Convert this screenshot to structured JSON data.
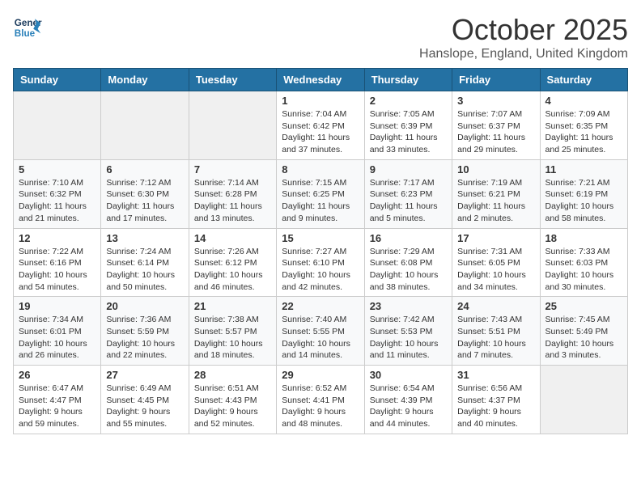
{
  "logo": {
    "line1": "General",
    "line2": "Blue"
  },
  "title": "October 2025",
  "location": "Hanslope, England, United Kingdom",
  "days_of_week": [
    "Sunday",
    "Monday",
    "Tuesday",
    "Wednesday",
    "Thursday",
    "Friday",
    "Saturday"
  ],
  "weeks": [
    [
      {
        "day": "",
        "info": ""
      },
      {
        "day": "",
        "info": ""
      },
      {
        "day": "",
        "info": ""
      },
      {
        "day": "1",
        "info": "Sunrise: 7:04 AM\nSunset: 6:42 PM\nDaylight: 11 hours\nand 37 minutes."
      },
      {
        "day": "2",
        "info": "Sunrise: 7:05 AM\nSunset: 6:39 PM\nDaylight: 11 hours\nand 33 minutes."
      },
      {
        "day": "3",
        "info": "Sunrise: 7:07 AM\nSunset: 6:37 PM\nDaylight: 11 hours\nand 29 minutes."
      },
      {
        "day": "4",
        "info": "Sunrise: 7:09 AM\nSunset: 6:35 PM\nDaylight: 11 hours\nand 25 minutes."
      }
    ],
    [
      {
        "day": "5",
        "info": "Sunrise: 7:10 AM\nSunset: 6:32 PM\nDaylight: 11 hours\nand 21 minutes."
      },
      {
        "day": "6",
        "info": "Sunrise: 7:12 AM\nSunset: 6:30 PM\nDaylight: 11 hours\nand 17 minutes."
      },
      {
        "day": "7",
        "info": "Sunrise: 7:14 AM\nSunset: 6:28 PM\nDaylight: 11 hours\nand 13 minutes."
      },
      {
        "day": "8",
        "info": "Sunrise: 7:15 AM\nSunset: 6:25 PM\nDaylight: 11 hours\nand 9 minutes."
      },
      {
        "day": "9",
        "info": "Sunrise: 7:17 AM\nSunset: 6:23 PM\nDaylight: 11 hours\nand 5 minutes."
      },
      {
        "day": "10",
        "info": "Sunrise: 7:19 AM\nSunset: 6:21 PM\nDaylight: 11 hours\nand 2 minutes."
      },
      {
        "day": "11",
        "info": "Sunrise: 7:21 AM\nSunset: 6:19 PM\nDaylight: 10 hours\nand 58 minutes."
      }
    ],
    [
      {
        "day": "12",
        "info": "Sunrise: 7:22 AM\nSunset: 6:16 PM\nDaylight: 10 hours\nand 54 minutes."
      },
      {
        "day": "13",
        "info": "Sunrise: 7:24 AM\nSunset: 6:14 PM\nDaylight: 10 hours\nand 50 minutes."
      },
      {
        "day": "14",
        "info": "Sunrise: 7:26 AM\nSunset: 6:12 PM\nDaylight: 10 hours\nand 46 minutes."
      },
      {
        "day": "15",
        "info": "Sunrise: 7:27 AM\nSunset: 6:10 PM\nDaylight: 10 hours\nand 42 minutes."
      },
      {
        "day": "16",
        "info": "Sunrise: 7:29 AM\nSunset: 6:08 PM\nDaylight: 10 hours\nand 38 minutes."
      },
      {
        "day": "17",
        "info": "Sunrise: 7:31 AM\nSunset: 6:05 PM\nDaylight: 10 hours\nand 34 minutes."
      },
      {
        "day": "18",
        "info": "Sunrise: 7:33 AM\nSunset: 6:03 PM\nDaylight: 10 hours\nand 30 minutes."
      }
    ],
    [
      {
        "day": "19",
        "info": "Sunrise: 7:34 AM\nSunset: 6:01 PM\nDaylight: 10 hours\nand 26 minutes."
      },
      {
        "day": "20",
        "info": "Sunrise: 7:36 AM\nSunset: 5:59 PM\nDaylight: 10 hours\nand 22 minutes."
      },
      {
        "day": "21",
        "info": "Sunrise: 7:38 AM\nSunset: 5:57 PM\nDaylight: 10 hours\nand 18 minutes."
      },
      {
        "day": "22",
        "info": "Sunrise: 7:40 AM\nSunset: 5:55 PM\nDaylight: 10 hours\nand 14 minutes."
      },
      {
        "day": "23",
        "info": "Sunrise: 7:42 AM\nSunset: 5:53 PM\nDaylight: 10 hours\nand 11 minutes."
      },
      {
        "day": "24",
        "info": "Sunrise: 7:43 AM\nSunset: 5:51 PM\nDaylight: 10 hours\nand 7 minutes."
      },
      {
        "day": "25",
        "info": "Sunrise: 7:45 AM\nSunset: 5:49 PM\nDaylight: 10 hours\nand 3 minutes."
      }
    ],
    [
      {
        "day": "26",
        "info": "Sunrise: 6:47 AM\nSunset: 4:47 PM\nDaylight: 9 hours\nand 59 minutes."
      },
      {
        "day": "27",
        "info": "Sunrise: 6:49 AM\nSunset: 4:45 PM\nDaylight: 9 hours\nand 55 minutes."
      },
      {
        "day": "28",
        "info": "Sunrise: 6:51 AM\nSunset: 4:43 PM\nDaylight: 9 hours\nand 52 minutes."
      },
      {
        "day": "29",
        "info": "Sunrise: 6:52 AM\nSunset: 4:41 PM\nDaylight: 9 hours\nand 48 minutes."
      },
      {
        "day": "30",
        "info": "Sunrise: 6:54 AM\nSunset: 4:39 PM\nDaylight: 9 hours\nand 44 minutes."
      },
      {
        "day": "31",
        "info": "Sunrise: 6:56 AM\nSunset: 4:37 PM\nDaylight: 9 hours\nand 40 minutes."
      },
      {
        "day": "",
        "info": ""
      }
    ]
  ]
}
